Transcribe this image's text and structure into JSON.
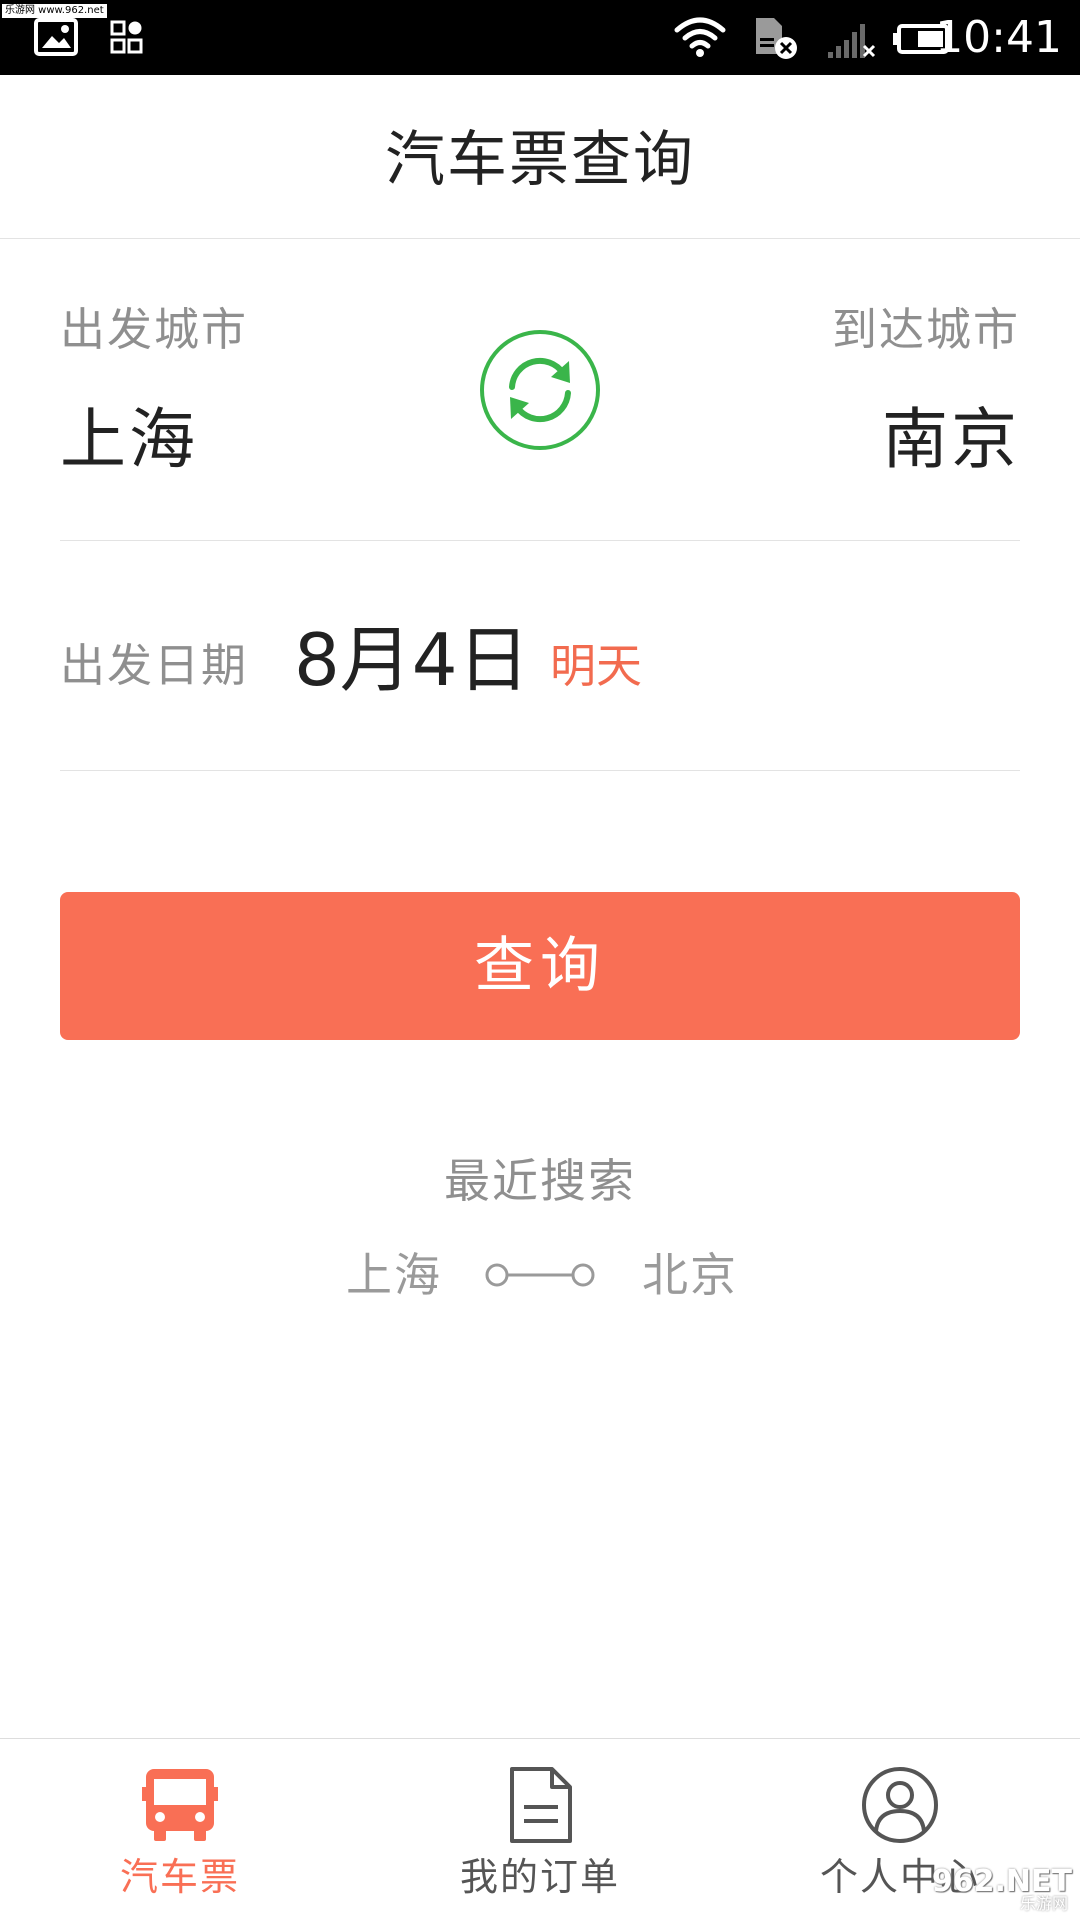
{
  "status_bar": {
    "time": "10:41",
    "watermark": "乐游网 www.962.net",
    "icons": [
      "image-icon",
      "apps-grid-icon",
      "wifi-icon",
      "sim-off-icon",
      "signal-off-icon",
      "battery-icon"
    ]
  },
  "header": {
    "title": "汽车票查询"
  },
  "route": {
    "depart_label": "出发城市",
    "depart_city": "上海",
    "arrive_label": "到达城市",
    "arrive_city": "南京",
    "swap_icon": "swap-cycle-icon"
  },
  "date": {
    "label": "出发日期",
    "value": "8月4日",
    "badge": "明天"
  },
  "search_button": {
    "label": "查询"
  },
  "recent": {
    "title": "最近搜索",
    "items": [
      {
        "from": "上海",
        "to": "北京"
      }
    ]
  },
  "bottom_nav": {
    "items": [
      {
        "label": "汽车票",
        "icon": "bus-icon",
        "active": true
      },
      {
        "label": "我的订单",
        "icon": "document-icon",
        "active": false
      },
      {
        "label": "个人中心",
        "icon": "user-icon",
        "active": false
      }
    ]
  },
  "watermark_corner": {
    "text": "962.NET",
    "sub": "乐游网"
  },
  "colors": {
    "accent": "#f96f55",
    "badge": "#f26b4f",
    "swap_green": "#3ab54a",
    "text_dark": "#222222",
    "text_grey": "#8f8f8f",
    "divider": "#e3e3e3"
  }
}
